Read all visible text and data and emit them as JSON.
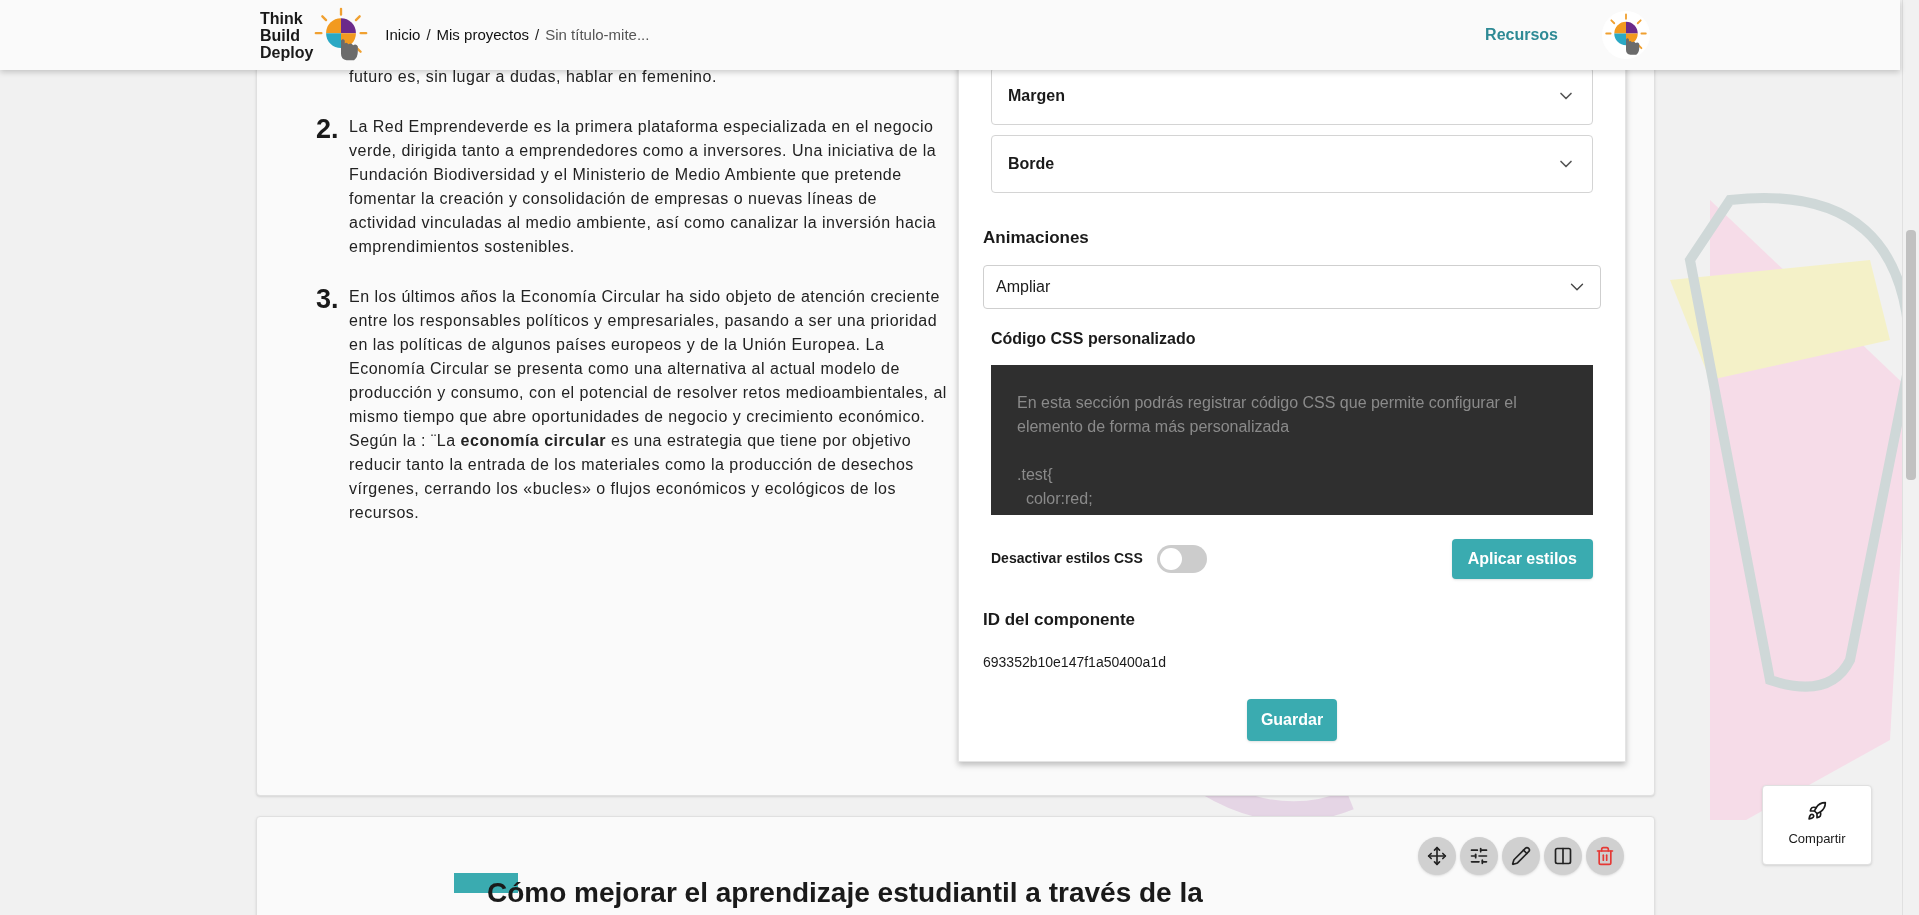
{
  "header": {
    "logo_words": [
      "Think",
      "Build",
      "Deploy"
    ],
    "breadcrumb": {
      "separator": "/",
      "items": [
        {
          "label": "Inicio",
          "current": false
        },
        {
          "label": "Mis proyectos",
          "current": false
        },
        {
          "label": "Sin título-mite...",
          "current": true
        }
      ]
    },
    "nav_link": "Recursos"
  },
  "content": {
    "fragment": "futuro es, sin lugar a dudas, hablar en femenino.",
    "items": [
      {
        "number": "2.",
        "paragraphs": [
          "La Red Emprendeverde es la primera plataforma especializada en el negocio verde, dirigida tanto a emprendedores como a inversores. Una iniciativa de la Fundación Biodiversidad y el Ministerio de Medio Ambiente que pretende fomentar la creación y consolidación de empresas o nuevas líneas de actividad vinculadas al medio ambiente, así como canalizar la inversión hacia emprendimientos sostenibles."
        ]
      },
      {
        "number": "3.",
        "paragraphs": [
          "En los últimos años la Economía Circular ha sido objeto de atención creciente entre los responsables políticos y empresariales, pasando a ser una prioridad en las políticas de algunos países europeos y de la Unión Europea. La Economía Circular se presenta como una alternativa al actual modelo de producción y consumo, con el potencial de resolver retos medioambientales, al mismo tiempo que abre oportunidades de negocio y crecimiento económico.",
          "Según la : ¨La **economía circular** es una estrategia que tiene por objetivo reducir tanto la entrada de los materiales como la producción de desechos vírgenes, cerrando los «bucles» o flujos económicos y ecológicos de los recursos."
        ]
      }
    ]
  },
  "settings": {
    "accordions": [
      {
        "label": "Margen",
        "expanded": false
      },
      {
        "label": "Borde",
        "expanded": false
      }
    ],
    "animations": {
      "label": "Animaciones",
      "value": "Ampliar"
    },
    "css": {
      "label": "Código CSS personalizado",
      "placeholder": "En esta sección podrás registrar código CSS que permite configurar el elemento de forma más personalizada\n\n.test{\n  color:red;"
    },
    "disable_css": {
      "label": "Desactivar estilos CSS",
      "on": false
    },
    "apply_button": "Aplicar estilos",
    "id_label": "ID del componente",
    "id_value": "693352b10e147f1a50400a1d",
    "save_button": "Guardar"
  },
  "next_block": {
    "title": "Cómo mejorar el aprendizaje estudiantil a través de la",
    "toolbar": [
      {
        "kind": "move"
      },
      {
        "kind": "adjust"
      },
      {
        "kind": "edit"
      },
      {
        "kind": "split"
      },
      {
        "kind": "delete"
      }
    ]
  },
  "share_button": "Compartir"
}
